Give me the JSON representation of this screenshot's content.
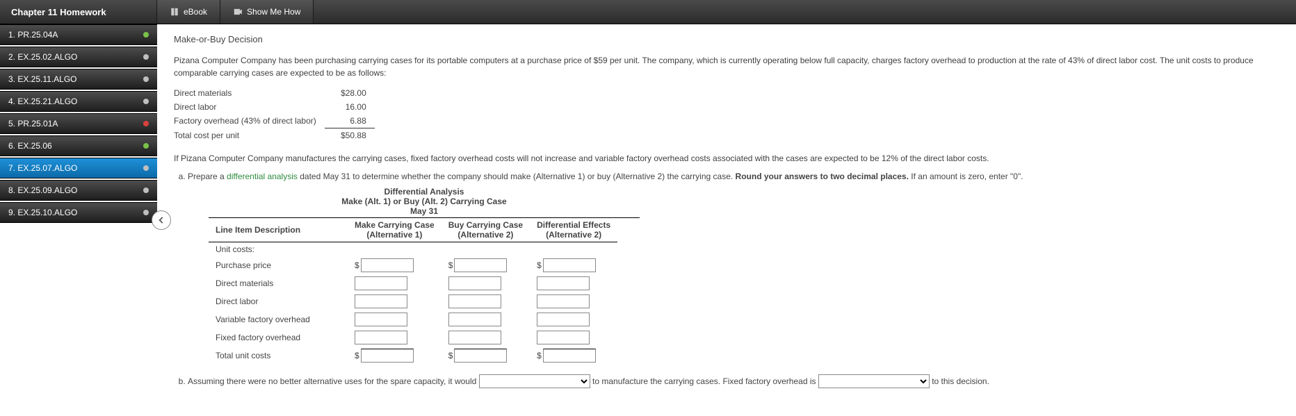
{
  "header": {
    "title": "Chapter 11 Homework",
    "buttons": {
      "ebook": "eBook",
      "showme": "Show Me How"
    }
  },
  "sidebar": {
    "items": [
      {
        "label": "1. PR.25.04A",
        "status": "green"
      },
      {
        "label": "2. EX.25.02.ALGO",
        "status": "gray"
      },
      {
        "label": "3. EX.25.11.ALGO",
        "status": "gray"
      },
      {
        "label": "4. EX.25.21.ALGO",
        "status": "gray"
      },
      {
        "label": "5. PR.25.01A",
        "status": "red"
      },
      {
        "label": "6. EX.25.06",
        "status": "green"
      },
      {
        "label": "7. EX.25.07.ALGO",
        "status": "gray",
        "active": true
      },
      {
        "label": "8. EX.25.09.ALGO",
        "status": "gray"
      },
      {
        "label": "9. EX.25.10.ALGO",
        "status": "gray"
      }
    ]
  },
  "problem": {
    "title": "Make-or-Buy Decision",
    "intro": "Pizana Computer Company has been purchasing carrying cases for its portable computers at a purchase price of $59 per unit. The company, which is currently operating below full capacity, charges factory overhead to production at the rate of 43% of direct labor cost. The unit costs to produce comparable carrying cases are expected to be as follows:",
    "costs": {
      "dm_label": "Direct materials",
      "dm": "$28.00",
      "dl_label": "Direct labor",
      "dl": "16.00",
      "foh_label": "Factory overhead (43% of direct labor)",
      "foh": "6.88",
      "tot_label": "Total cost per unit",
      "tot": "$50.88"
    },
    "note": "If Pizana Computer Company manufactures the carrying cases, fixed factory overhead costs will not increase and variable factory overhead costs associated with the cases are expected to be 12% of the direct labor costs.",
    "q_a_prefix": "Prepare a ",
    "q_a_link": "differential analysis",
    "q_a_suffix": " dated May 31 to determine whether the company should make (Alternative 1) or buy (Alternative 2) the carrying case. ",
    "q_a_bold": "Round your answers to two decimal places.",
    "q_a_tail": " If an amount is zero, enter \"0\".",
    "diff": {
      "h1": "Differential Analysis",
      "h2": "Make (Alt. 1) or Buy (Alt. 2) Carrying Case",
      "h3": "May 31",
      "col0": "Line Item Description",
      "col1a": "Make Carrying Case",
      "col1b": "(Alternative 1)",
      "col2a": "Buy Carrying Case",
      "col2b": "(Alternative 2)",
      "col3a": "Differential Effects",
      "col3b": "(Alternative 2)",
      "rows": {
        "unit": "Unit costs:",
        "pp": "Purchase price",
        "dm": "Direct materials",
        "dl": "Direct labor",
        "vfoh": "Variable factory overhead",
        "ffoh": "Fixed factory overhead",
        "tot": "Total unit costs"
      }
    },
    "q_b_1": "Assuming there were no better alternative uses for the spare capacity, it would ",
    "q_b_2": " to manufacture the carrying cases. Fixed factory overhead is ",
    "q_b_3": " to this decision."
  },
  "status_colors": {
    "green": "#7ac14a",
    "red": "#d9413e",
    "gray": "#bfbfbf"
  }
}
